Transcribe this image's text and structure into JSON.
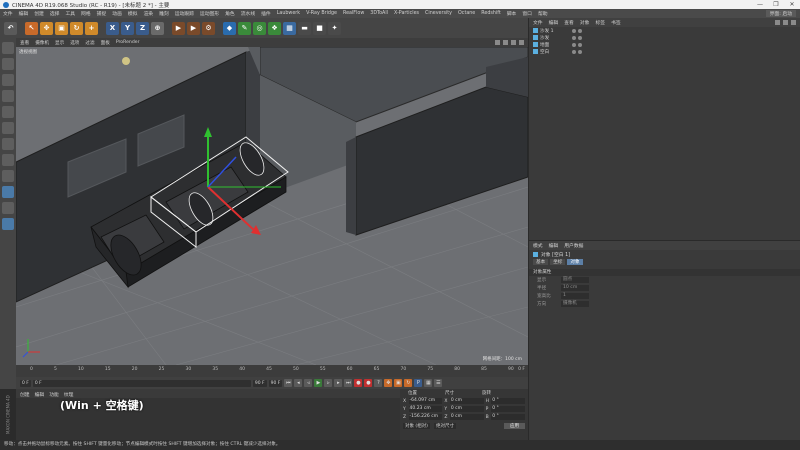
{
  "window": {
    "title": "CINEMA 4D R19.068 Studio (RC - R19) - [未标题 2 *] - 主要",
    "controls": [
      "—",
      "❐",
      "✕"
    ]
  },
  "menu": {
    "items": [
      "文件",
      "编辑",
      "创建",
      "选择",
      "工具",
      "网格",
      "捕捉",
      "动画",
      "模拟",
      "渲染",
      "雕刻",
      "运动跟踪",
      "运动图形",
      "角色",
      "流水线",
      "插件",
      "Laubwerk",
      "V-Ray Bridge",
      "RealFlow",
      "3DToAll",
      "X-Particles",
      "Cineversity",
      "Octane",
      "Redshift",
      "脚本",
      "窗口",
      "帮助"
    ],
    "layout_label": "界面",
    "layout_value": "启动"
  },
  "viewport": {
    "menu": [
      "查看",
      "摄像机",
      "显示",
      "选项",
      "过滤",
      "面板",
      "ProRender"
    ],
    "corner_label": "透视视图",
    "grid_label": "网格间距：100 cm"
  },
  "timeline": {
    "ticks": [
      "0",
      "5",
      "10",
      "15",
      "20",
      "25",
      "30",
      "35",
      "40",
      "45",
      "50",
      "55",
      "60",
      "65",
      "70",
      "75",
      "80",
      "85",
      "90"
    ],
    "end_label": "0 F"
  },
  "anim": {
    "start": "0 F",
    "current": "0 F",
    "end": "90 F",
    "end2": "90 F"
  },
  "materials": {
    "tabs": [
      "创建",
      "编辑",
      "功能",
      "纹理"
    ],
    "caption": "(Win + 空格键)"
  },
  "coords": {
    "headers": [
      "位置",
      "尺寸",
      "旋转"
    ],
    "rows": [
      {
        "axis": "X",
        "pos": "-64.097 cm",
        "size": "0 cm",
        "rot_label": "H",
        "rot": "0 °"
      },
      {
        "axis": "Y",
        "pos": "40.23 cm",
        "size": "0 cm",
        "rot_label": "P",
        "rot": "0 °"
      },
      {
        "axis": "Z",
        "pos": "-156.226 cm",
        "size": "0 cm",
        "rot_label": "B",
        "rot": "0 °"
      }
    ],
    "mode1": "对象 (相对)",
    "mode2": "绝对尺寸",
    "apply": "应用"
  },
  "side_strip_label": "MAXON CINEMA 4D",
  "status": "移动：点击并拖动鼠标移动元素。按住 SHIFT 键量化移动；节点编辑模式时按住 SHIFT 键增加选择对象；按住 CTRL 键减少选择对象。",
  "object_manager": {
    "menu": [
      "文件",
      "编辑",
      "查看",
      "对象",
      "标签",
      "书签"
    ],
    "objects": [
      "沙发 1",
      "沙发",
      "地面",
      "空白"
    ]
  },
  "attribute_manager": {
    "menu": [
      "模式",
      "编辑",
      "用户数据"
    ],
    "object_title": "对象 [空白 1]",
    "tabs": [
      "基本",
      "坐标",
      "对象"
    ],
    "section": "对象属性",
    "rows": [
      {
        "label": "显示",
        "value": "圆点"
      },
      {
        "label": "半径",
        "value": "10 cm"
      },
      {
        "label": "宽高比",
        "value": "1"
      },
      {
        "label": "方向",
        "value": "摄像机"
      }
    ]
  },
  "colors": {
    "accent_active_tab": "#5c7fa6",
    "axis_x": "#e03030",
    "axis_y": "#30c030",
    "axis_z": "#3050e0"
  }
}
